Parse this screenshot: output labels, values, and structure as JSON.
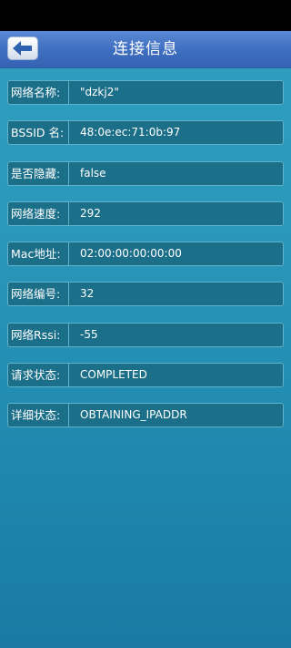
{
  "header": {
    "title": "连接信息",
    "back_icon": "arrow-left-icon"
  },
  "info_rows": [
    {
      "label": "网络名称:",
      "value": "\"dzkj2\""
    },
    {
      "label": "BSSID 名:",
      "value": " 48:0e:ec:71:0b:97"
    },
    {
      "label": "是否隐藏:",
      "value": "false"
    },
    {
      "label": "网络速度:",
      "value": "292"
    },
    {
      "label": "Mac地址:",
      "value": "02:00:00:00:00:00"
    },
    {
      "label": "网络编号:",
      "value": "32"
    },
    {
      "label": "网络Rssi:",
      "value": "-55"
    },
    {
      "label": "请求状态:",
      "value": "COMPLETED"
    },
    {
      "label": "详细状态:",
      "value": "OBTAINING_IPADDR"
    }
  ],
  "colors": {
    "title_bar": "#3f6fc0",
    "background": "#2a98bb",
    "row_fill": "#1c6f89",
    "row_border": "#5fb2c9"
  }
}
